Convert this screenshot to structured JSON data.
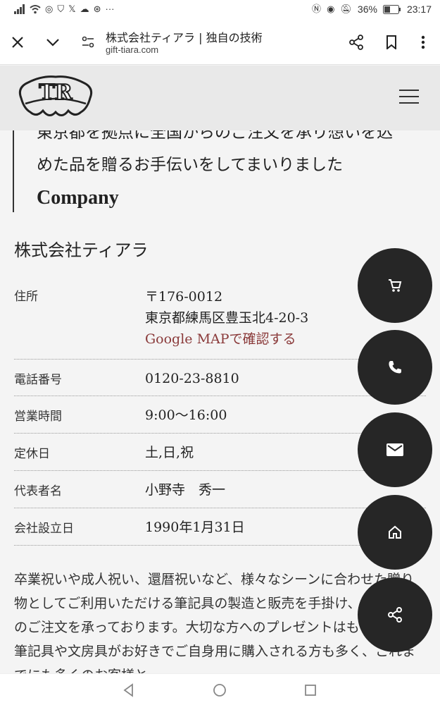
{
  "status_bar": {
    "battery": "36%",
    "time": "23:17"
  },
  "browser": {
    "page_title": "株式会社ティアラ | 独自の技術",
    "url": "gift-tiara.com"
  },
  "site": {
    "logo_text": "TR"
  },
  "intro": {
    "line1": "東京都を拠点に全国からのご注文を承り想いを込",
    "line2": "めた品を贈るお手伝いをしてまいりました",
    "heading": "Company"
  },
  "company": {
    "name": "株式会社ティアラ",
    "rows": [
      {
        "label": "住所",
        "values": [
          "〒176-0012",
          "東京都練馬区豊玉北4-20-3"
        ],
        "link": "Google MAPで確認する"
      },
      {
        "label": "電話番号",
        "values": [
          "0120-23-8810"
        ]
      },
      {
        "label": "営業時間",
        "values": [
          "9:00〜16:00"
        ]
      },
      {
        "label": "定休日",
        "values": [
          "土,日,祝"
        ]
      },
      {
        "label": "代表者名",
        "values": [
          "小野寺　秀一"
        ]
      },
      {
        "label": "会社設立日",
        "values": [
          "1990年1月31日"
        ]
      }
    ],
    "description": "卒業祝いや成人祝い、還暦祝いなど、様々なシーンに合わせた贈り物としてご利用いただける筆記具の製造と販売を手掛け、全国からのご注文を承っております。大切な方へのプレゼントはもちろん、筆記具や文房具がお好きでご自身用に購入される方も多く、これまでにも多くのお客様と"
  },
  "fabs": [
    "cart-icon",
    "phone-icon",
    "mail-icon",
    "home-icon",
    "share-icon"
  ],
  "colors": {
    "fab": "#262626",
    "link": "#8a3a3a",
    "header": "#e9e9e9"
  }
}
